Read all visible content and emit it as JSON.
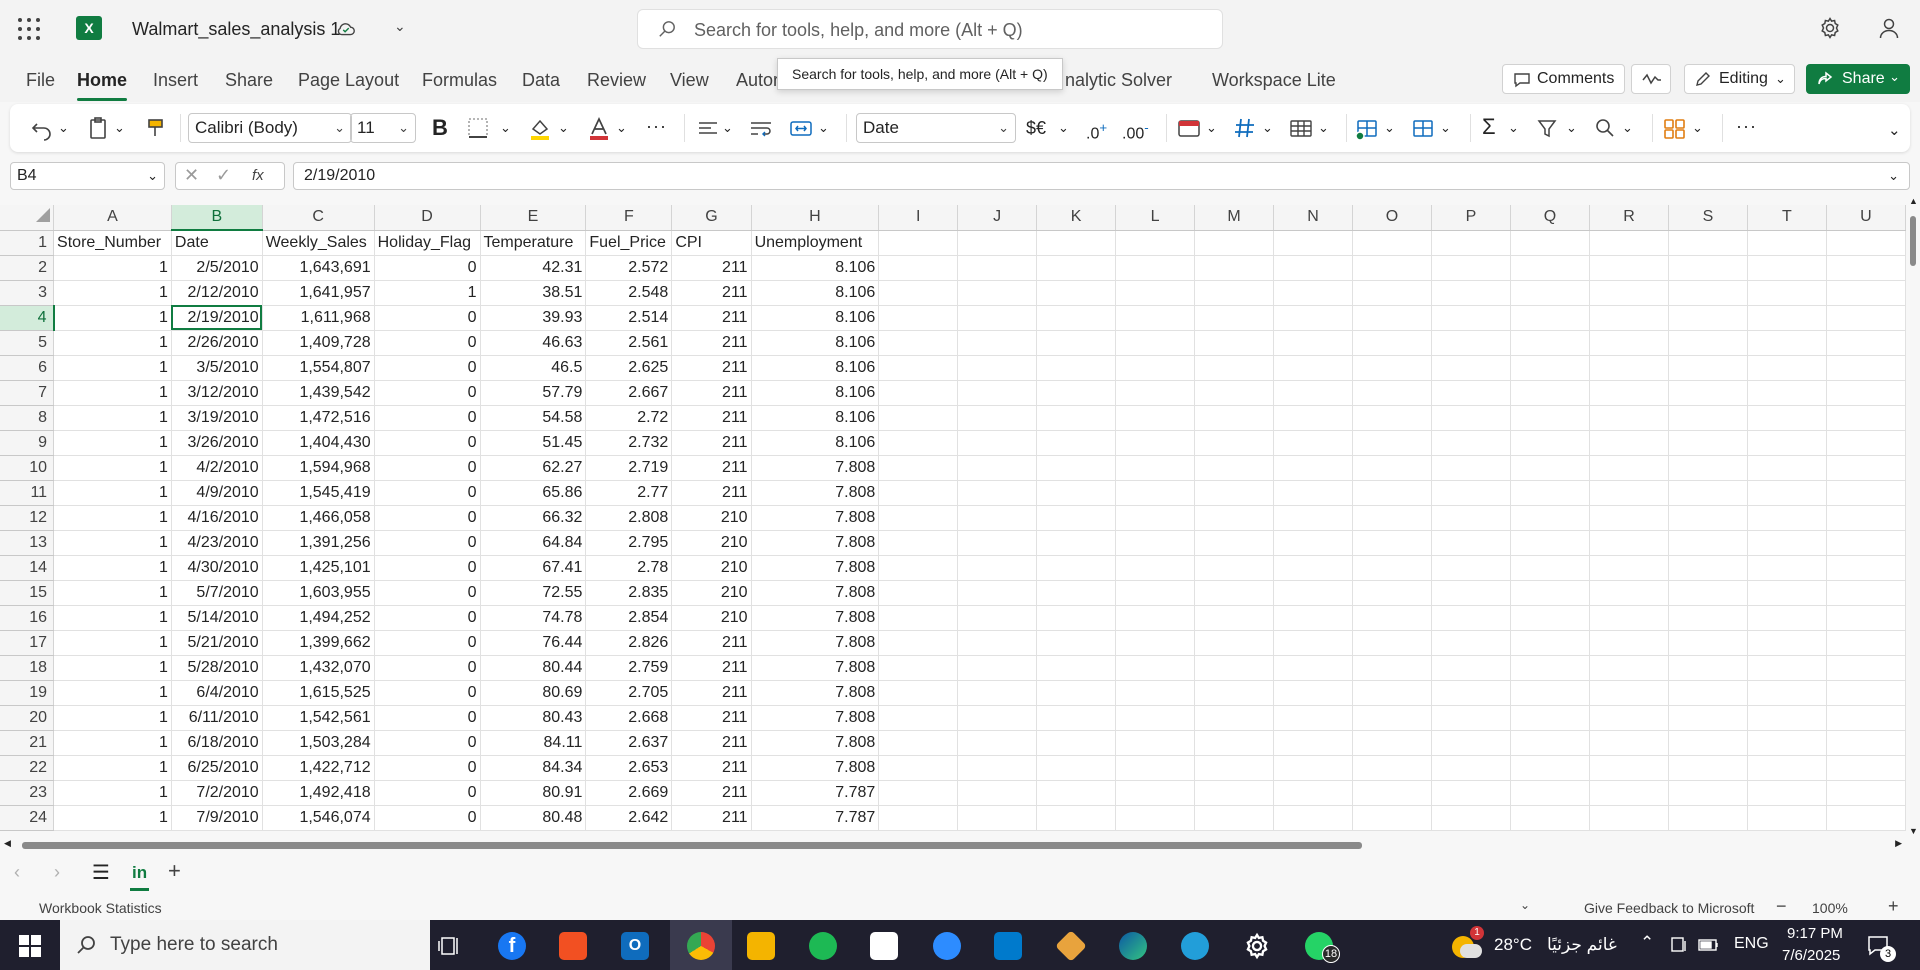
{
  "app": {
    "title": "Walmart_sales_analysis 1",
    "logo_letter": "X"
  },
  "search": {
    "placeholder": "Search for tools, help, and more (Alt + Q)",
    "tooltip": "Search for tools, help, and more (Alt + Q)"
  },
  "tabs": [
    "File",
    "Home",
    "Insert",
    "Share",
    "Page Layout",
    "Formulas",
    "Data",
    "Review",
    "View",
    "Autor",
    "nalytic Solver",
    "Workspace Lite"
  ],
  "header_buttons": {
    "comments": "Comments",
    "editing": "Editing",
    "share": "Share"
  },
  "ribbon": {
    "font_name": "Calibri (Body)",
    "font_size": "11",
    "number_format": "Date",
    "bold": "B",
    "ellipsis": "···"
  },
  "formula_bar": {
    "name_box": "B4",
    "value": "2/19/2010",
    "fx": "fx"
  },
  "columns": [
    "A",
    "B",
    "C",
    "D",
    "E",
    "F",
    "G",
    "H",
    "I",
    "J",
    "K",
    "L",
    "M",
    "N",
    "O",
    "P",
    "Q",
    "R",
    "S",
    "T",
    "U"
  ],
  "headers": [
    "Store_Number",
    "Date",
    "Weekly_Sales",
    "Holiday_Flag",
    "Temperature",
    "Fuel_Price",
    "CPI",
    "Unemployment"
  ],
  "rows": [
    [
      "1",
      "2/5/2010",
      "1,643,691",
      "0",
      "42.31",
      "2.572",
      "211",
      "8.106"
    ],
    [
      "1",
      "2/12/2010",
      "1,641,957",
      "1",
      "38.51",
      "2.548",
      "211",
      "8.106"
    ],
    [
      "1",
      "2/19/2010",
      "1,611,968",
      "0",
      "39.93",
      "2.514",
      "211",
      "8.106"
    ],
    [
      "1",
      "2/26/2010",
      "1,409,728",
      "0",
      "46.63",
      "2.561",
      "211",
      "8.106"
    ],
    [
      "1",
      "3/5/2010",
      "1,554,807",
      "0",
      "46.5",
      "2.625",
      "211",
      "8.106"
    ],
    [
      "1",
      "3/12/2010",
      "1,439,542",
      "0",
      "57.79",
      "2.667",
      "211",
      "8.106"
    ],
    [
      "1",
      "3/19/2010",
      "1,472,516",
      "0",
      "54.58",
      "2.72",
      "211",
      "8.106"
    ],
    [
      "1",
      "3/26/2010",
      "1,404,430",
      "0",
      "51.45",
      "2.732",
      "211",
      "8.106"
    ],
    [
      "1",
      "4/2/2010",
      "1,594,968",
      "0",
      "62.27",
      "2.719",
      "211",
      "7.808"
    ],
    [
      "1",
      "4/9/2010",
      "1,545,419",
      "0",
      "65.86",
      "2.77",
      "211",
      "7.808"
    ],
    [
      "1",
      "4/16/2010",
      "1,466,058",
      "0",
      "66.32",
      "2.808",
      "210",
      "7.808"
    ],
    [
      "1",
      "4/23/2010",
      "1,391,256",
      "0",
      "64.84",
      "2.795",
      "210",
      "7.808"
    ],
    [
      "1",
      "4/30/2010",
      "1,425,101",
      "0",
      "67.41",
      "2.78",
      "210",
      "7.808"
    ],
    [
      "1",
      "5/7/2010",
      "1,603,955",
      "0",
      "72.55",
      "2.835",
      "210",
      "7.808"
    ],
    [
      "1",
      "5/14/2010",
      "1,494,252",
      "0",
      "74.78",
      "2.854",
      "210",
      "7.808"
    ],
    [
      "1",
      "5/21/2010",
      "1,399,662",
      "0",
      "76.44",
      "2.826",
      "211",
      "7.808"
    ],
    [
      "1",
      "5/28/2010",
      "1,432,070",
      "0",
      "80.44",
      "2.759",
      "211",
      "7.808"
    ],
    [
      "1",
      "6/4/2010",
      "1,615,525",
      "0",
      "80.69",
      "2.705",
      "211",
      "7.808"
    ],
    [
      "1",
      "6/11/2010",
      "1,542,561",
      "0",
      "80.43",
      "2.668",
      "211",
      "7.808"
    ],
    [
      "1",
      "6/18/2010",
      "1,503,284",
      "0",
      "84.11",
      "2.637",
      "211",
      "7.808"
    ],
    [
      "1",
      "6/25/2010",
      "1,422,712",
      "0",
      "84.34",
      "2.653",
      "211",
      "7.808"
    ],
    [
      "1",
      "7/2/2010",
      "1,492,418",
      "0",
      "80.91",
      "2.669",
      "211",
      "7.787"
    ],
    [
      "1",
      "7/9/2010",
      "1,546,074",
      "0",
      "80.48",
      "2.642",
      "211",
      "7.787"
    ]
  ],
  "selection": {
    "column": "B",
    "row": 4
  },
  "sheets": [
    "in"
  ],
  "status": {
    "left": "Workbook Statistics",
    "feedback": "Give Feedback to Microsoft",
    "zoom": "100%"
  },
  "taskbar": {
    "search_placeholder": "Type here to search",
    "weather": "28°C",
    "weather_text": "غائم جزئيًا",
    "lang": "ENG",
    "time": "9:17 PM",
    "date": "7/6/2025",
    "whatsapp_badge": "18",
    "notif_badge": "3",
    "weather_badge": "1"
  },
  "colors": {
    "accent": "#107c41",
    "selection_bg": "#d3ecdb"
  }
}
